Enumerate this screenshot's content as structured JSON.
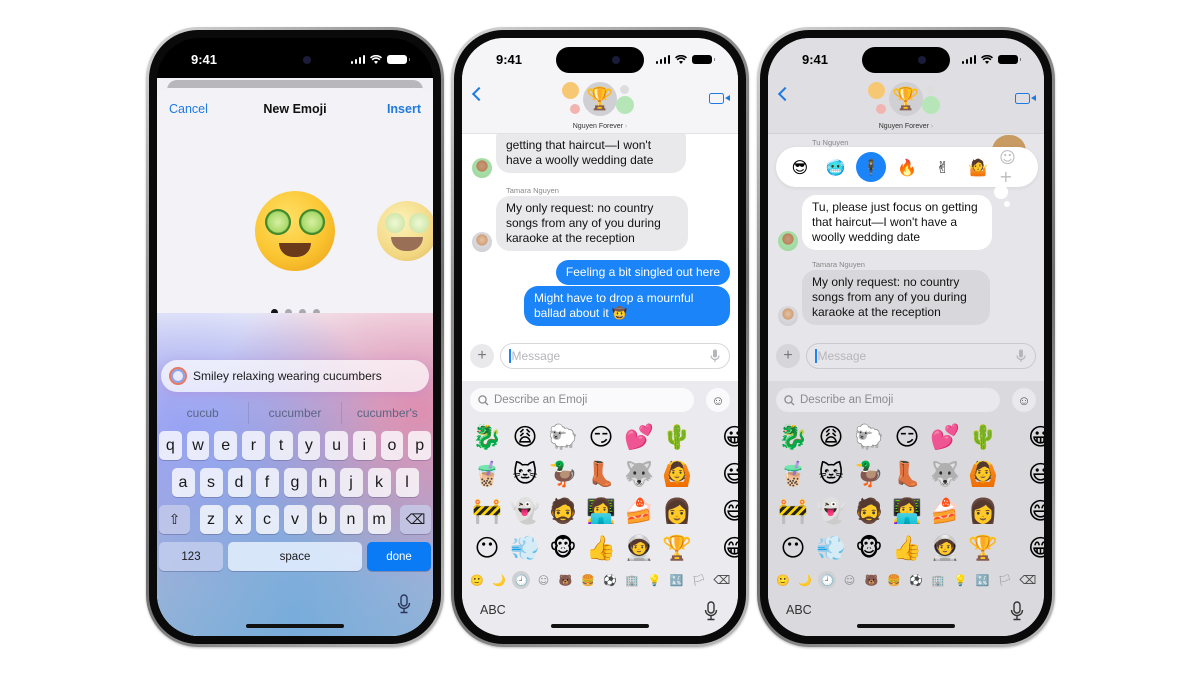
{
  "status_bar": {
    "time": "9:41"
  },
  "phone1": {
    "nav": {
      "cancel": "Cancel",
      "title": "New Emoji",
      "insert": "Insert"
    },
    "preview": {
      "current_emoji": "smiley-with-cucumber-eyes",
      "next_emoji": "grinning-with-cucumber-eyes",
      "page": 1,
      "page_count": 4
    },
    "prompt": {
      "icon": "image-playground-icon",
      "text": "Smiley relaxing wearing cucumbers"
    },
    "suggestions": [
      "cucub",
      "cucumber",
      "cucumber's"
    ],
    "keyboard": {
      "row1": [
        "q",
        "w",
        "e",
        "r",
        "t",
        "y",
        "u",
        "i",
        "o",
        "p"
      ],
      "row2": [
        "a",
        "s",
        "d",
        "f",
        "g",
        "h",
        "j",
        "k",
        "l"
      ],
      "row3": [
        "z",
        "x",
        "c",
        "v",
        "b",
        "n",
        "m"
      ],
      "shift": "⇧",
      "delete": "⌫",
      "numbers": "123",
      "space": "space",
      "done": "done"
    }
  },
  "conversation": {
    "group_name": "Nguyen Forever",
    "group_avatar": "🏆",
    "messages": [
      {
        "sender": "Tu Nguyen",
        "direction": "in",
        "text": "Tu, please just focus on getting that haircut—I won't have a woolly wedding date"
      },
      {
        "sender": "Tamara Nguyen",
        "direction": "in",
        "text": "My only request: no country songs from any of you during karaoke at the reception"
      },
      {
        "direction": "out",
        "text": "Feeling a bit singled out here"
      },
      {
        "direction": "out",
        "text": "Might have to drop a mournful ballad about it 🤠"
      }
    ],
    "phone2_first_partial_line": "Tu, please just focus on",
    "phone2_first_rest": "getting that haircut—I won't have a woolly wedding date",
    "compose_placeholder": "Message"
  },
  "emoji_keyboard": {
    "search_placeholder": "Describe an Emoji",
    "grid": [
      [
        "🐉",
        "😩",
        "🐑",
        "😏",
        "💕",
        "🌵"
      ],
      [
        "🧋",
        "🐱",
        "🦆",
        "👢",
        "🐺",
        "🙆"
      ],
      [
        "🚧",
        "👻",
        "🧔",
        "👩‍💻",
        "🍰",
        "👩"
      ],
      [
        "😶",
        "💨",
        "🐵",
        "👍",
        "🧑‍🚀",
        "🏆"
      ]
    ],
    "edge_column": [
      "😀",
      "😃",
      "😄",
      "😁"
    ],
    "categories": [
      "🙂",
      "🌙",
      "🕘",
      "☺",
      "🐻",
      "🍔",
      "⚽",
      "🏢",
      "💡",
      "🔣",
      "🏳"
    ],
    "active_category_index": 2,
    "abc_label": "ABC"
  },
  "tapback": {
    "reactions": [
      "😎",
      "🥶",
      "🕴",
      "🔥",
      "✌",
      "🤷"
    ],
    "selected_index": 2,
    "add_icon": "☺+"
  },
  "phone3": {
    "partial_sender": "Tu Nguyen",
    "first_message_lines": "Tu, please just focus on getting that haircut—I won't have a woolly wedding date"
  },
  "colors": {
    "ios_blue": "#1a84f8",
    "done_key": "#0a7bf5",
    "link_blue": "#1f7ae0"
  }
}
